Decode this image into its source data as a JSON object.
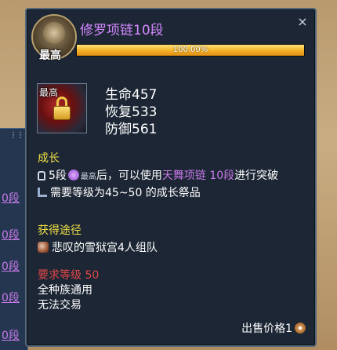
{
  "background": {
    "links": [
      "0段",
      "0段",
      "0段",
      "0段",
      "0段"
    ]
  },
  "tooltip": {
    "close_icon": "×",
    "emblem_label": "最高",
    "title": "修罗项链10段",
    "progress": {
      "percent": 100,
      "label": "100.00%"
    },
    "item": {
      "icon_label": "最高",
      "stats": [
        "生命457",
        "恢复533",
        "防御561"
      ]
    },
    "growth": {
      "title": "成长",
      "line1": {
        "prefix": "5段",
        "badge": "最高",
        "middle": "后，可以使用",
        "link": "天舞项链 10段",
        "suffix": "进行突破"
      },
      "line2": "需要等级为45~50 的成长祭品"
    },
    "source": {
      "title": "获得途径",
      "item": "悲叹的雪狱宫4人组队"
    },
    "requirement": {
      "title": "要求等级 50",
      "lines": [
        "全种族通用",
        "无法交易"
      ]
    },
    "sale": {
      "label": "出售价格1"
    },
    "colors": {
      "title": "#d488ff",
      "section": "#f0e046",
      "requirement": "#e04848",
      "link": "#c87ae8",
      "progress": "#f5b52a"
    }
  }
}
